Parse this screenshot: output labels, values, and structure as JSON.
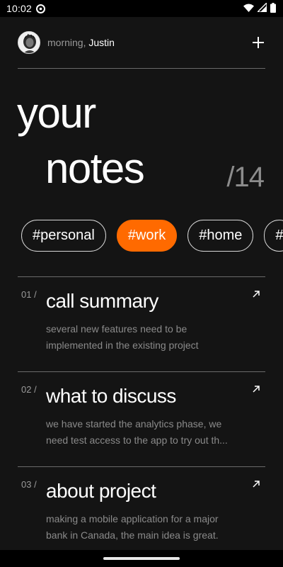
{
  "status_bar": {
    "time": "10:02"
  },
  "header": {
    "greeting": "morning,",
    "user_name": "Justin"
  },
  "title": {
    "line1": "your",
    "line2": "notes",
    "count": "/14"
  },
  "tags": [
    {
      "label": "#personal",
      "active": false
    },
    {
      "label": "#work",
      "active": true
    },
    {
      "label": "#home",
      "active": false
    },
    {
      "label": "#",
      "active": false
    }
  ],
  "notes": [
    {
      "index": "01 /",
      "title": "call summary",
      "body": "several new features need to be implemented in the existing project"
    },
    {
      "index": "02 /",
      "title": "what to discuss",
      "body": "we have started the analytics phase, we need test access to the app to try out th..."
    },
    {
      "index": "03 /",
      "title": "about project",
      "body": "making a mobile application for a major bank in Canada, the main idea is great."
    }
  ],
  "colors": {
    "background": "#141414",
    "accent": "#ff6a00",
    "muted": "#8a8a8a"
  },
  "icons": [
    "gear-icon",
    "wifi-icon",
    "signal-icon",
    "battery-icon",
    "plus-icon",
    "arrow-up-right-icon"
  ]
}
